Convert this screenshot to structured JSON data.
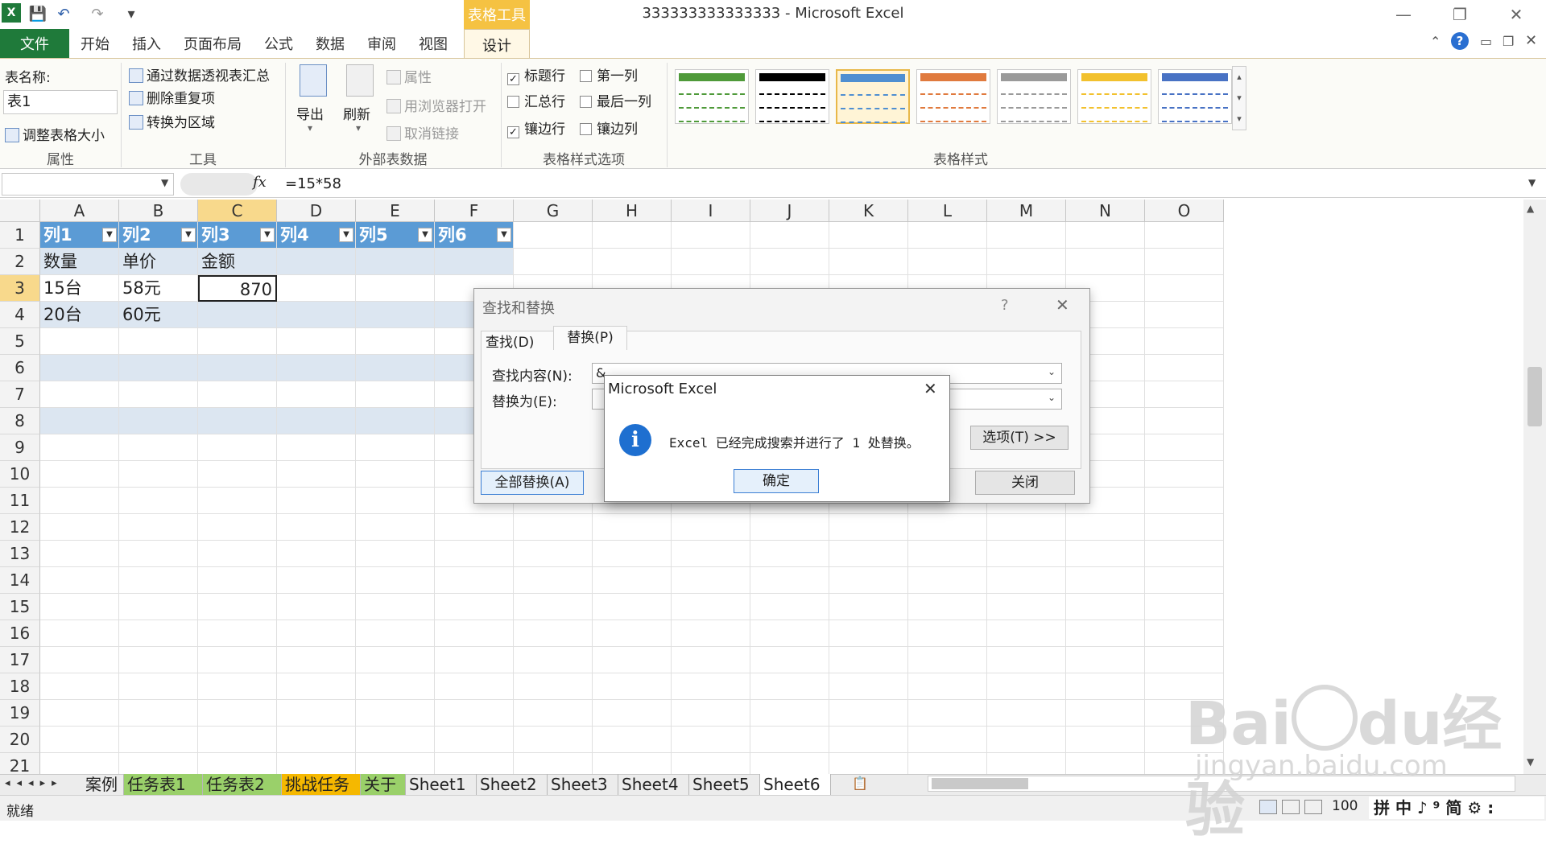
{
  "window": {
    "title": "333333333333333  -  Microsoft Excel",
    "min": "—",
    "restore": "❐",
    "close": "✕"
  },
  "quick_access": {
    "save": "💾",
    "undo": "↶",
    "redo": "↷",
    "customize": "▾"
  },
  "ribbon": {
    "file_tab": "文件",
    "tabs": [
      "开始",
      "插入",
      "页面布局",
      "公式",
      "数据",
      "审阅",
      "视图"
    ],
    "context_group": "表格工具",
    "context_tab": "设计",
    "groups": {
      "properties": {
        "label": "属性",
        "table_name_label": "表名称:",
        "table_name_value": "表1",
        "resize": "调整表格大小"
      },
      "tools": {
        "label": "工具",
        "pivot": "通过数据透视表汇总",
        "remove_dup": "删除重复项",
        "convert": "转换为区域"
      },
      "external": {
        "label": "外部表数据",
        "export": "导出",
        "refresh": "刷新",
        "properties": "属性",
        "open_browser": "用浏览器打开",
        "unlink": "取消链接"
      },
      "style_options": {
        "label": "表格样式选项",
        "header_row": "标题行",
        "total_row": "汇总行",
        "banded_rows": "镶边行",
        "first_col": "第一列",
        "last_col": "最后一列",
        "banded_cols": "镶边列"
      },
      "styles": {
        "label": "表格样式",
        "swatches": [
          "#4f9a3a",
          "#000000",
          "#4f8fd1",
          "#e07a3e",
          "#9a9a9a",
          "#f2c12e",
          "#4872c4"
        ]
      }
    }
  },
  "formula_bar": {
    "name_box": "",
    "fx": "fx",
    "formula": "=15*58"
  },
  "columns": [
    "A",
    "B",
    "C",
    "D",
    "E",
    "F",
    "G",
    "H",
    "I",
    "J",
    "K",
    "L",
    "M",
    "N",
    "O"
  ],
  "rows": [
    "1",
    "2",
    "3",
    "4",
    "5",
    "6",
    "7",
    "8",
    "9",
    "10",
    "11",
    "12",
    "13",
    "14",
    "15",
    "16",
    "17",
    "18",
    "19",
    "20",
    "21"
  ],
  "table": {
    "headers": [
      "列1",
      "列2",
      "列3",
      "列4",
      "列5",
      "列6"
    ],
    "row2": [
      "数量",
      "单价",
      "金额"
    ],
    "row3": [
      "15台",
      "58元",
      "870"
    ],
    "row4": [
      "20台",
      "60元"
    ]
  },
  "sheets": [
    "案例",
    "任务表1",
    "任务表2",
    "挑战任务",
    "关于",
    "Sheet1",
    "Sheet2",
    "Sheet3",
    "Sheet4",
    "Sheet5",
    "Sheet6"
  ],
  "status": {
    "ready": "就绪",
    "zoom": "100",
    "ime": "拼 中 ♪ ⁹ 简 ⚙ :"
  },
  "find_dialog": {
    "title": "查找和替换",
    "help": "?",
    "close": "✕",
    "tab_find": "查找(D)",
    "tab_replace": "替换(P)",
    "find_label": "查找内容(N):",
    "find_value": "&",
    "replace_label": "替换为(E):",
    "options": "选项(T) >>",
    "replace_all": "全部替换(A)",
    "close_btn": "关闭"
  },
  "message_box": {
    "title": "Microsoft Excel",
    "close": "✕",
    "icon": "i",
    "message": "Excel 已经完成搜索并进行了 1 处替换。",
    "ok": "确定"
  },
  "watermark": {
    "brand": "Bai",
    "brand2": "du",
    "suffix": "经验",
    "url": "jingyan.baidu.com"
  }
}
